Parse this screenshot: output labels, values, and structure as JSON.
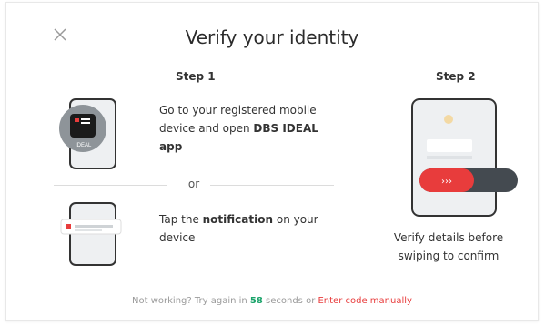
{
  "header": {
    "title": "Verify your identity"
  },
  "step1": {
    "label": "Step 1",
    "instruction_a_prefix": "Go to your registered mobile device and open ",
    "instruction_a_bold": "DBS IDEAL app",
    "or_text": "or",
    "instruction_b_prefix": "Tap the ",
    "instruction_b_bold": "notification",
    "instruction_b_suffix": " on your device",
    "app_icon_text": "IDEAL"
  },
  "step2": {
    "label": "Step 2",
    "instruction": "Verify details before swiping to confirm",
    "swipe_arrows": "›››"
  },
  "footer": {
    "prefix": "Not working? Try again in ",
    "seconds": "58",
    "middle": " seconds or ",
    "link": "Enter code manually"
  },
  "colors": {
    "accent_red": "#e83c3c",
    "timer_green": "#1aa36a"
  },
  "icons": [
    "close-icon"
  ]
}
